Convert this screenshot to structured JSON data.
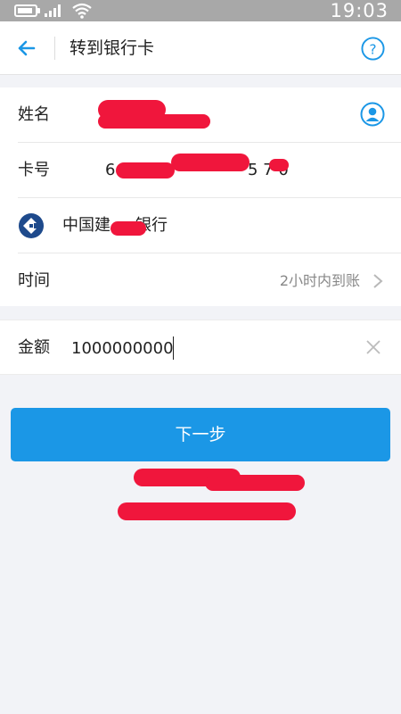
{
  "status_bar": {
    "time": "19:03"
  },
  "nav": {
    "title": "转到银行卡"
  },
  "recipient": {
    "name_label": "姓名",
    "card_label": "卡号",
    "card_number_start": "6",
    "card_number_end": "5 7 0",
    "bank_name_start": "中国建",
    "bank_name_end": "银行",
    "time_label": "时间",
    "time_value": "2小时内到账"
  },
  "amount": {
    "label": "金额",
    "value": "1000000000"
  },
  "next_button": {
    "label": "下一步"
  },
  "colors": {
    "accent": "#1b97e6",
    "redaction": "#f0163c",
    "bank_logo": "#1e4a8c"
  },
  "icons": [
    "back-arrow-icon",
    "help-icon",
    "contact-icon",
    "bank-logo-icon",
    "chevron-right-icon",
    "clear-icon"
  ]
}
